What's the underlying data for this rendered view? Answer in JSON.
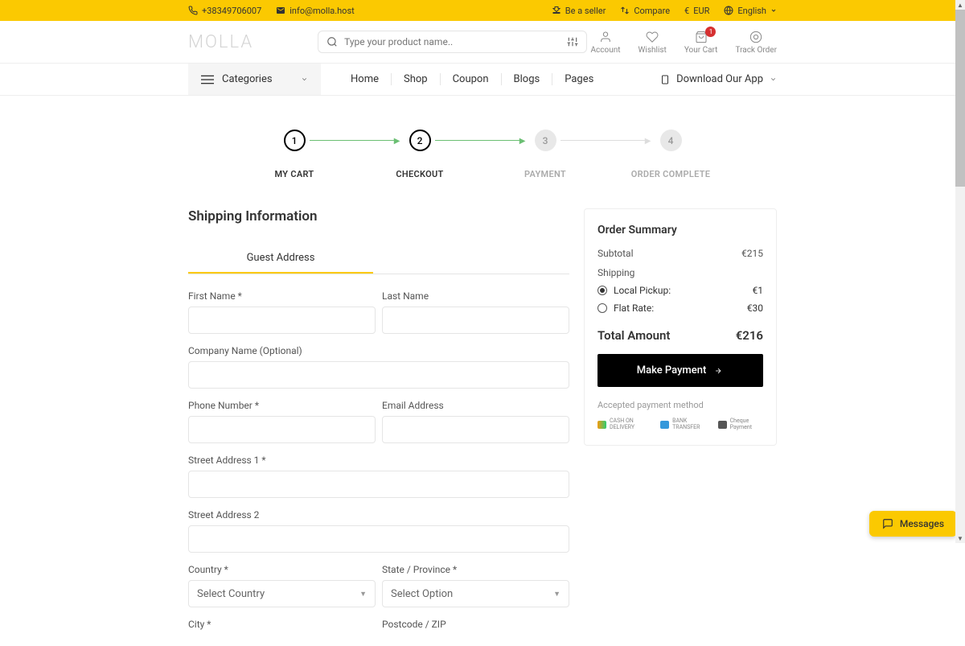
{
  "topbar": {
    "phone": "+38349706007",
    "email": "info@molla.host",
    "be_seller": "Be a seller",
    "compare": "Compare",
    "currency": "EUR",
    "language": "English"
  },
  "header": {
    "logo": "MOLLA",
    "search_placeholder": "Type your product name..",
    "account": "Account",
    "wishlist": "Wishlist",
    "cart": "Your Cart",
    "cart_count": "1",
    "track": "Track Order"
  },
  "nav": {
    "categories": "Categories",
    "links": [
      "Home",
      "Shop",
      "Coupon",
      "Blogs",
      "Pages"
    ],
    "download": "Download Our App"
  },
  "steps": [
    {
      "num": "1",
      "label": "MY CART"
    },
    {
      "num": "2",
      "label": "CHECKOUT"
    },
    {
      "num": "3",
      "label": "PAYMENT"
    },
    {
      "num": "4",
      "label": "ORDER COMPLETE"
    }
  ],
  "shipping": {
    "title": "Shipping Information",
    "tab": "Guest Address",
    "fields": {
      "first_name": "First Name *",
      "last_name": "Last Name",
      "company": "Company Name (Optional)",
      "phone": "Phone Number *",
      "email": "Email Address",
      "street1": "Street Address 1 *",
      "street2": "Street Address 2",
      "country": "Country *",
      "state": "State / Province *",
      "city": "City *",
      "postcode": "Postcode / ZIP",
      "select_country": "Select Country",
      "select_option": "Select Option"
    }
  },
  "summary": {
    "title": "Order Summary",
    "subtotal_label": "Subtotal",
    "subtotal_value": "€215",
    "shipping_label": "Shipping",
    "options": [
      {
        "label": "Local Pickup:",
        "value": "€1",
        "checked": true
      },
      {
        "label": "Flat Rate:",
        "value": "€30",
        "checked": false
      }
    ],
    "total_label": "Total Amount",
    "total_value": "€216",
    "button": "Make Payment",
    "accepted": "Accepted payment method",
    "methods": [
      {
        "name": "CASH ON DELIVERY"
      },
      {
        "name": "BANK TRANSFER"
      },
      {
        "name": "Cheque Payment"
      }
    ]
  },
  "messages": "Messages"
}
